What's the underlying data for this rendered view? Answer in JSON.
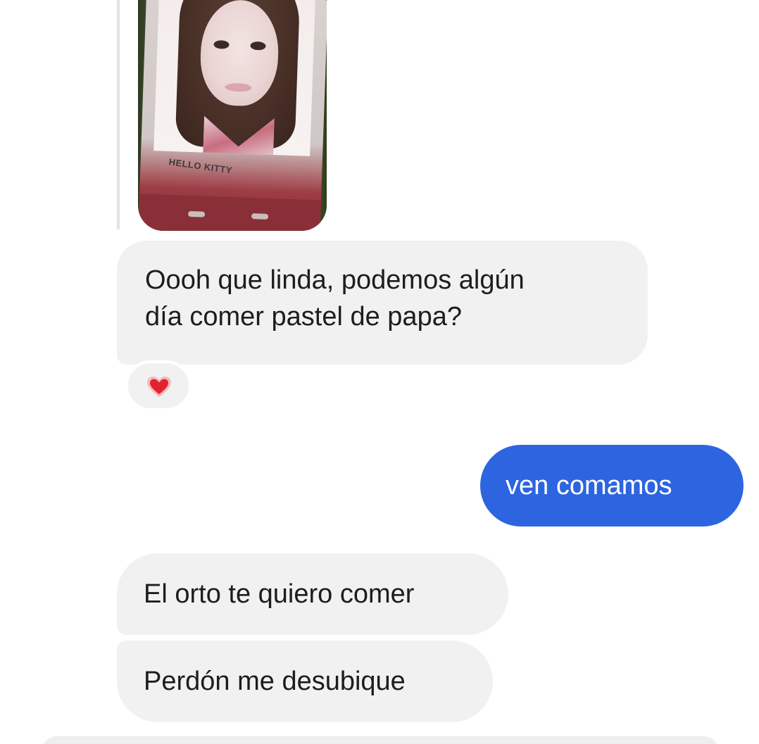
{
  "photo_message": {
    "image_alt": "Selfie photo on a phone screen",
    "brand_text": "HELLO KITTY"
  },
  "messages": [
    {
      "id": "m1",
      "direction": "incoming",
      "text": "Oooh que linda, podemos algún\ndía comer pastel de papa?"
    },
    {
      "id": "m2",
      "direction": "outgoing",
      "text": "ven comamos"
    },
    {
      "id": "m3",
      "direction": "incoming",
      "text": "El orto te quiero comer"
    },
    {
      "id": "m4",
      "direction": "incoming",
      "text": "Perdón me desubique"
    }
  ],
  "reaction": {
    "icon": "heart-icon",
    "color": "#e0242f"
  },
  "colors": {
    "incoming_bubble": "#f1f1f1",
    "outgoing_bubble": "#2d65e0"
  }
}
